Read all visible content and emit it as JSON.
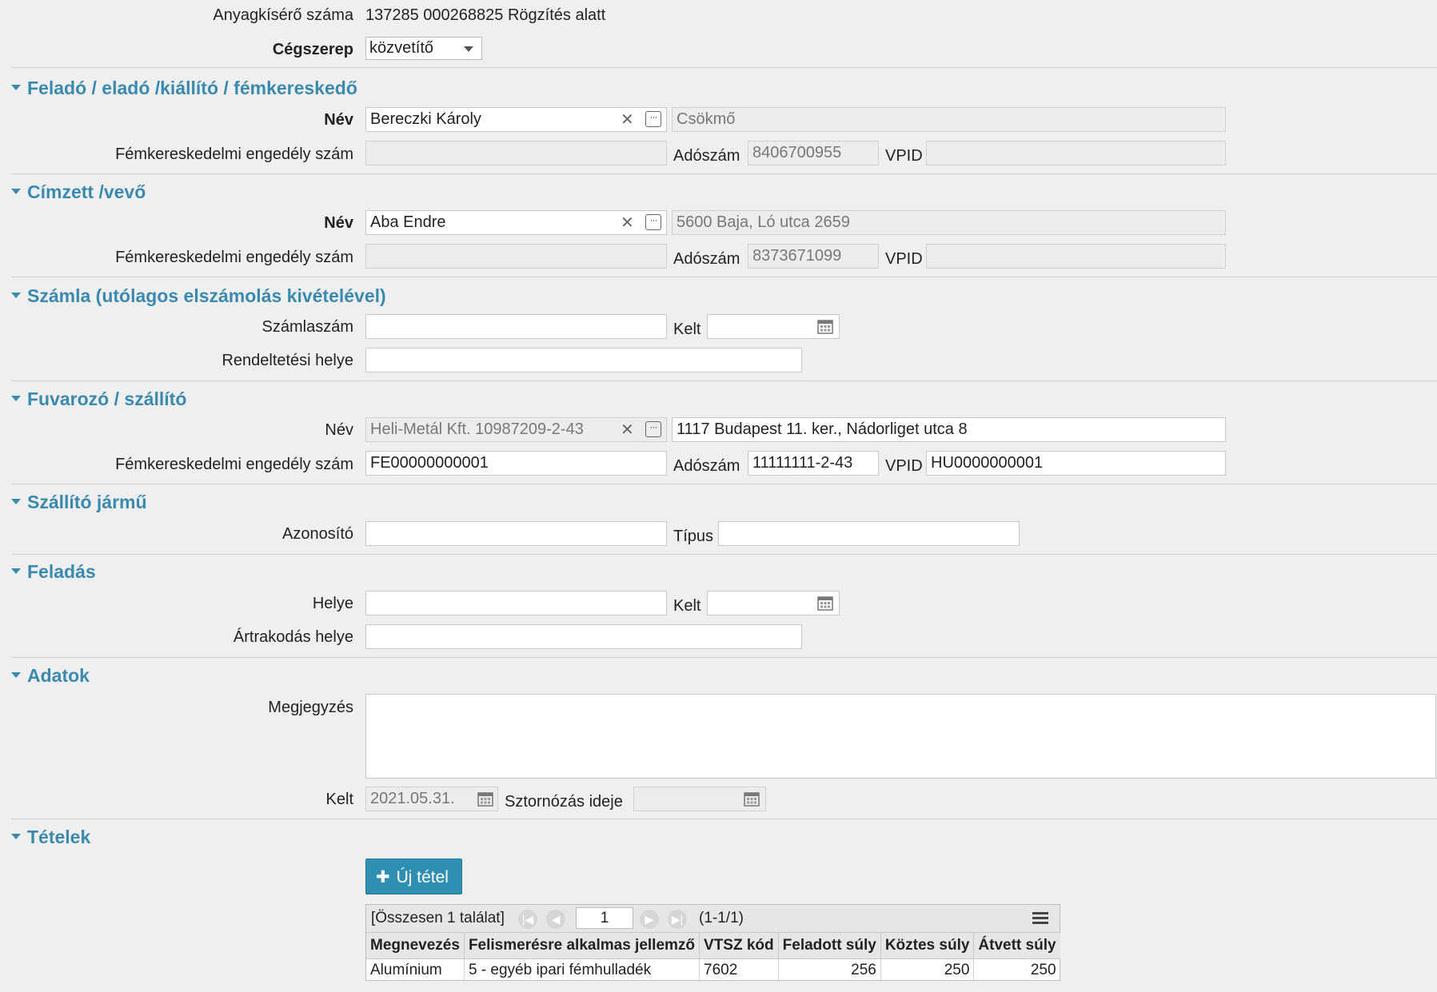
{
  "header": {
    "doc_number_label": "Anyagkísérő száma",
    "doc_number_value": "137285 000268825 Rögzítés alatt",
    "role_label": "Cégszerep",
    "role_value": "közvetítő"
  },
  "sender": {
    "title": "Feladó / eladó /kiállító / fémkereskedő",
    "name_label": "Név",
    "name_value": "Bereczki Károly",
    "address_value": "Csökmő",
    "license_label": "Fémkereskedelmi engedély szám",
    "license_value": "",
    "tax_label": "Adószám",
    "tax_value": "8406700955",
    "vpid_label": "VPID",
    "vpid_value": ""
  },
  "recipient": {
    "title": "Címzett /vevő",
    "name_label": "Név",
    "name_value": "Aba Endre",
    "address_value": "5600 Baja, Ló utca 2659",
    "license_label": "Fémkereskedelmi engedély szám",
    "license_value": "",
    "tax_label": "Adószám",
    "tax_value": "8373671099",
    "vpid_label": "VPID",
    "vpid_value": ""
  },
  "invoice": {
    "title": "Számla (utólagos elszámolás kivételével)",
    "number_label": "Számlaszám",
    "number_value": "",
    "date_label": "Kelt",
    "date_value": "",
    "destination_label": "Rendeltetési helye",
    "destination_value": ""
  },
  "carrier": {
    "title": "Fuvarozó / szállító",
    "name_label": "Név",
    "name_value": "Heli-Metál Kft. 10987209-2-43",
    "address_value": "1117 Budapest 11. ker., Nádorliget utca 8",
    "license_label": "Fémkereskedelmi engedély szám",
    "license_value": "FE00000000001",
    "tax_label": "Adószám",
    "tax_value": "11111111-2-43",
    "vpid_label": "VPID",
    "vpid_value": "HU0000000001"
  },
  "vehicle": {
    "title": "Szállító jármű",
    "id_label": "Azonosító",
    "id_value": "",
    "type_label": "Típus",
    "type_value": ""
  },
  "dispatch": {
    "title": "Feladás",
    "place_label": "Helye",
    "place_value": "",
    "date_label": "Kelt",
    "date_value": "",
    "transship_label": "Ártrakodás helye",
    "transship_value": ""
  },
  "data": {
    "title": "Adatok",
    "note_label": "Megjegyzés",
    "note_value": "",
    "date_label": "Kelt",
    "date_value": "2021.05.31.",
    "storno_label": "Sztornózás ideje",
    "storno_value": ""
  },
  "items": {
    "title": "Tételek",
    "new_button": "Új tétel",
    "total_text": "[Összesen 1 találat]",
    "page_value": "1",
    "range_text": "(1-1/1)",
    "columns": [
      "Megnevezés",
      "Felismerésre alkalmas jellemző",
      "VTSZ kód",
      "Feladott súly",
      "Köztes súly",
      "Átvett súly"
    ],
    "rows": [
      [
        "Alumínium",
        "5 - egyéb ipari fémhulladék",
        "7602",
        "256",
        "250",
        "250"
      ]
    ]
  },
  "icons": {
    "clear": "close-icon",
    "more": "ellipsis-icon",
    "calendar": "calendar-icon",
    "collapse": "triangle-down-icon",
    "add": "plus-icon",
    "menu": "hamburger-icon"
  },
  "colors": {
    "accent": "#3a8ab0",
    "button": "#2f8fb3",
    "background": "#efefef"
  }
}
